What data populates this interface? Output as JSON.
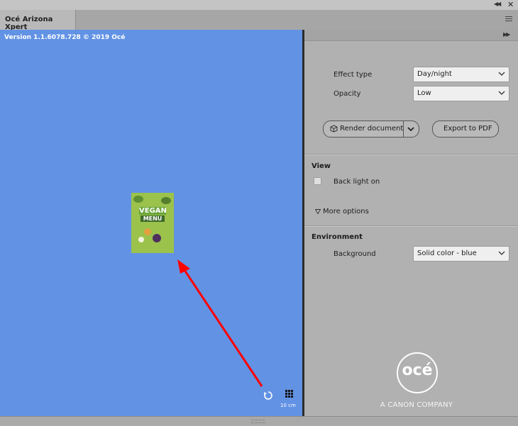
{
  "app": {
    "tab_title": "Océ Arizona Xpert",
    "version": "Version 1.1.6078.728 © 2019 Océ"
  },
  "window_controls": {
    "collapse_icon": "double-chevron-left-icon",
    "close_icon": "close-icon",
    "menu_icon": "hamburger-menu-icon",
    "expand_icon": "double-chevron-right-icon"
  },
  "viewport": {
    "background_color": "#6292e4",
    "poster": {
      "line1": "VEGAN",
      "line2": "MENU"
    },
    "scale_label": "10 cm",
    "refresh_icon": "refresh-icon",
    "grid_icon": "grid-icon",
    "annotation_color": "#ff0000"
  },
  "settings": {
    "effect_type": {
      "label": "Effect type",
      "value": "Day/night"
    },
    "opacity": {
      "label": "Opacity",
      "value": "Low"
    },
    "render_button": "Render document",
    "export_button": "Export to PDF"
  },
  "view": {
    "title": "View",
    "back_light_label": "Back light on",
    "back_light_checked": false,
    "more_options": "More options"
  },
  "environment": {
    "title": "Environment",
    "background_label": "Background",
    "background_value": "Solid color - blue"
  },
  "branding": {
    "logo_text": "océ",
    "tagline": "A CANON COMPANY"
  }
}
